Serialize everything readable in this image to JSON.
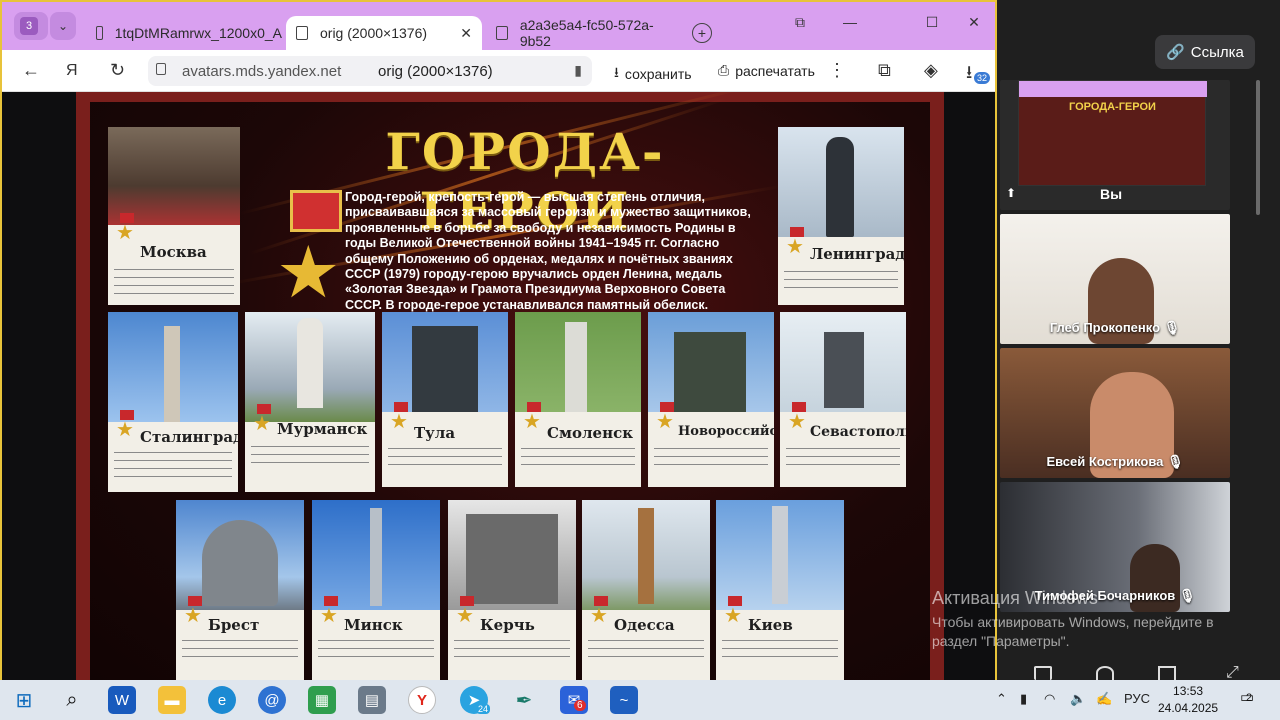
{
  "browser": {
    "tab_counter": "3",
    "tabs": [
      {
        "title": "1tqDtMRamrwx_1200x0_A",
        "active": false
      },
      {
        "title": "orig (2000×1376)",
        "active": true
      },
      {
        "title": "a2a3e5a4-fc50-572a-9b52",
        "active": false
      }
    ],
    "nav_letter": "Я",
    "address_host": "avatars.mds.yandex.net",
    "address_title": "orig (2000×1376)",
    "save_label": "сохранить",
    "print_label": "распечатать",
    "downloads_badge": "32"
  },
  "poster": {
    "title": "ГОРОДА-ГЕРОИ",
    "intro": "Город-герой, крепость-герой — высшая степень отличия, присваивавшаяся за массовый героизм и мужество защитников, проявленные в борьбе за свободу и независимость Родины в годы Великой Отечественной войны 1941–1945 гг. Согласно общему Положению об орденах, медалях и почётных званиях СССР (1979) городу-герою вручались орден Ленина, медаль «Золотая Звезда» и Грамота Президиума Верховного Совета СССР. В городе-герое устанавливался памятный обелиск.",
    "cities": {
      "moscow": "Москва",
      "leningrad": "Ленинград",
      "stalingrad": "Сталинград",
      "murmansk": "Мурманск",
      "tula": "Тула",
      "smolensk": "Смоленск",
      "novorossiysk": "Новороссийск",
      "sevastopol": "Севастополь",
      "brest": "Брест",
      "minsk": "Минск",
      "kerch": "Керчь",
      "odessa": "Одесса",
      "kiev": "Киев"
    }
  },
  "call": {
    "link_label": "Ссылка",
    "self_label": "Вы",
    "participants": [
      "Глеб Прокопенко",
      "Евсей Кострикова",
      "Тимофей Бочарников"
    ]
  },
  "activation": {
    "line1": "Активация Windows",
    "line2": "Чтобы активировать Windows, перейдите в раздел \"Параметры\"."
  },
  "taskbar": {
    "language": "РУС",
    "time": "13:53",
    "date": "24.04.2025",
    "notifications": "2",
    "telegram_badge": "24",
    "app_badge": "6"
  }
}
